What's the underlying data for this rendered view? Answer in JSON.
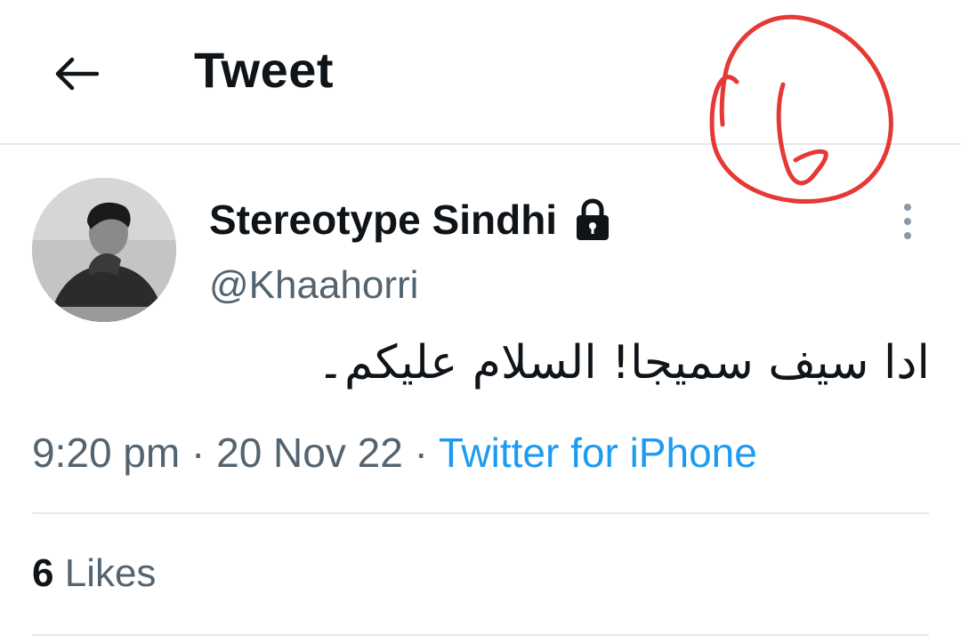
{
  "header": {
    "title": "Tweet",
    "back_icon": "arrow-left-icon"
  },
  "annotation": {
    "text": "6",
    "color": "#e53935"
  },
  "tweet": {
    "author": {
      "display_name": "Stereotype Sindhi",
      "handle": "@Khaahorri",
      "protected_icon": "lock-icon"
    },
    "text": "ادا سیف سمیجا! السلام علیکم۔",
    "time": "9:20 pm",
    "date": "20 Nov 22",
    "separator": "·",
    "source": "Twitter for iPhone",
    "likes_count": "6",
    "likes_label": "Likes",
    "more_icon": "more-vertical-icon"
  },
  "colors": {
    "text_primary": "#0f1419",
    "text_secondary": "#536471",
    "link": "#1d9bf0",
    "divider": "#e6e8ea"
  }
}
